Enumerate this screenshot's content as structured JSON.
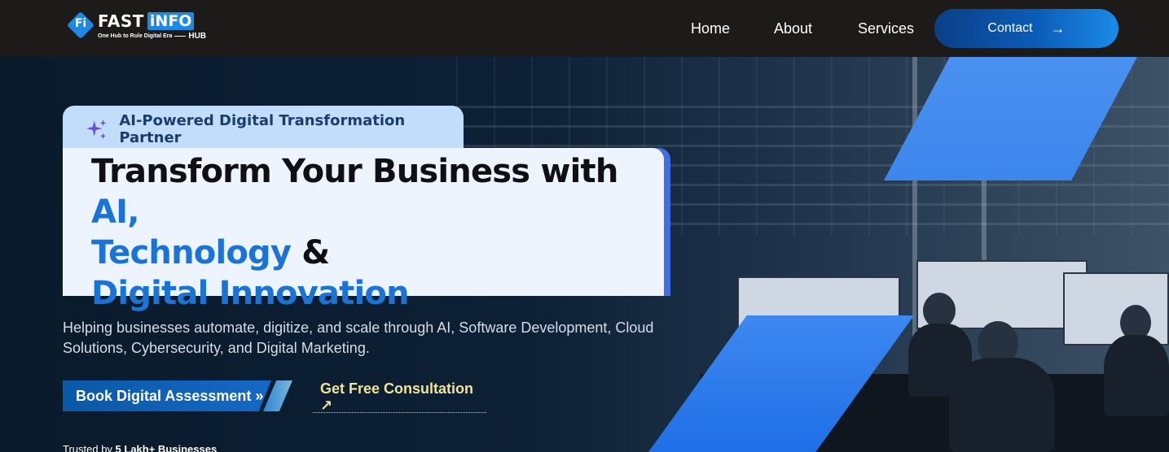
{
  "brand": {
    "mark": "Fi",
    "name_part1": "FAST",
    "name_part2": "iNFO",
    "tagline": "One Hub to Rule Digital Era",
    "suffix": "HUB"
  },
  "nav": {
    "items": [
      {
        "label": "Home"
      },
      {
        "label": "About"
      },
      {
        "label": "Services"
      }
    ],
    "contact": {
      "label": "Contact",
      "arrow": "→"
    }
  },
  "hero": {
    "badge": "AI-Powered Digital Transformation Partner",
    "headline": {
      "part1": "Transform Your Business with ",
      "highlight1": "AI,",
      "highlight2": "Technology",
      "part2": " &",
      "highlight3": "Digital Innovation"
    },
    "subtext": "Helping businesses automate, digitize, and scale through AI, Software Development, Cloud Solutions, Cybersecurity, and Digital Marketing.",
    "primary_cta": "Book Digital Assessment »",
    "secondary_cta": "Get Free Consultation ↗",
    "trusted_prefix": "Trusted by ",
    "trusted_count": "5 Lakh+ Businesses"
  },
  "colors": {
    "navbar_bg": "#1d1a1a",
    "accent_blue": "#1b73d6",
    "stripe_blue": "#3d86ec",
    "badge_bg": "#c2dcfc",
    "secondary_cta": "#f2e39a"
  },
  "icons": [
    "logo-icon",
    "sparkle-icon",
    "arrow-right-icon"
  ]
}
